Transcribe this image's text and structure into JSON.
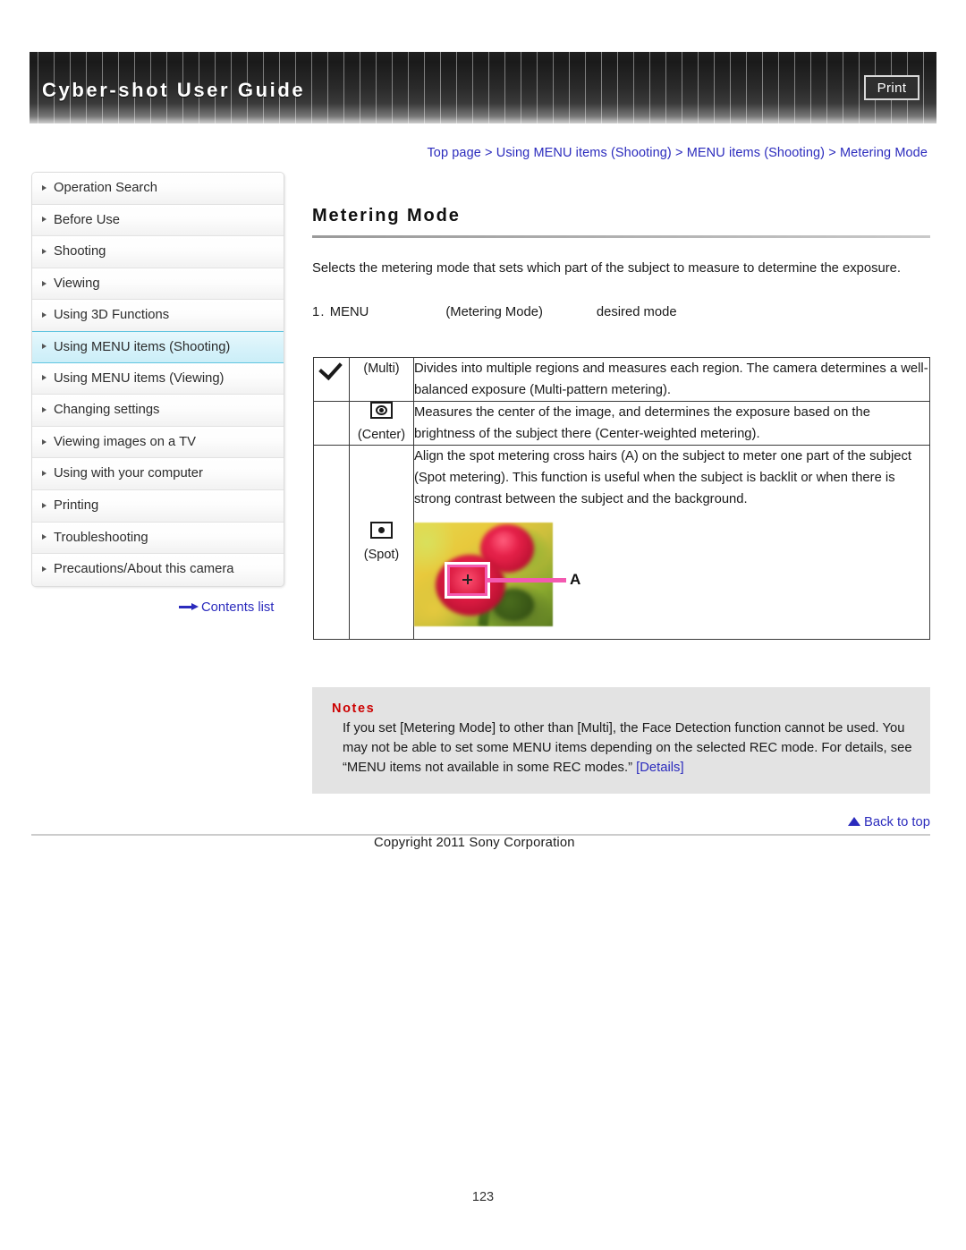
{
  "header": {
    "title": "Cyber-shot User Guide",
    "print_label": "Print"
  },
  "breadcrumb": {
    "full": "Top page > Using MENU items (Shooting) > MENU items (Shooting) > Metering Mode",
    "items": [
      "Top page",
      "Using MENU items (Shooting)",
      "MENU items (Shooting)",
      "Metering Mode"
    ],
    "separator": ">"
  },
  "sidebar": {
    "items": [
      {
        "label": "Operation Search",
        "active": false
      },
      {
        "label": "Before Use",
        "active": false
      },
      {
        "label": "Shooting",
        "active": false
      },
      {
        "label": "Viewing",
        "active": false
      },
      {
        "label": "Using 3D Functions",
        "active": false
      },
      {
        "label": "Using MENU items (Shooting)",
        "active": true
      },
      {
        "label": "Using MENU items (Viewing)",
        "active": false
      },
      {
        "label": "Changing settings",
        "active": false
      },
      {
        "label": "Viewing images on a TV",
        "active": false
      },
      {
        "label": "Using with your computer",
        "active": false
      },
      {
        "label": "Printing",
        "active": false
      },
      {
        "label": "Troubleshooting",
        "active": false
      },
      {
        "label": "Precautions/About this camera",
        "active": false
      }
    ],
    "contents_link": "Contents list"
  },
  "main": {
    "title": "Metering Mode",
    "intro": "Selects the metering mode that sets which part of the subject to measure to determine the exposure.",
    "step": {
      "number": "1.",
      "menu": "MENU",
      "setting": "(Metering Mode)",
      "target": "desired mode"
    },
    "table": {
      "rows": [
        {
          "checked": true,
          "icon": "check-icon",
          "label": "(Multi)",
          "description": "Divides into multiple regions and measures each region. The camera determines a well-balanced exposure (Multi-pattern metering)."
        },
        {
          "checked": false,
          "icon": "center-metering-icon",
          "label": "(Center)",
          "description": "Measures the center of the image, and determines the exposure based on the brightness of the subject there (Center-weighted metering)."
        },
        {
          "checked": false,
          "icon": "spot-metering-icon",
          "label": "(Spot)",
          "description": "Align the spot metering cross hairs (A) on the subject to meter one part of the subject (Spot metering). This function is useful when the subject is backlit or when there is strong contrast between the subject and the background.",
          "photo_caption": "A"
        }
      ]
    },
    "notes": {
      "title": "Notes",
      "body_1": "If you set [Metering Mode] to other than [Multi], the Face Detection function cannot be used. You may not be able to set some MENU items depending on the selected REC mode. For details, see “MENU items not available in some REC modes.” ",
      "details_link": "[Details]"
    }
  },
  "footer": {
    "back_to_top": "Back to top",
    "copyright": "Copyright 2011 Sony Corporation",
    "page_number": "123"
  },
  "colors": {
    "link": "#2b2bbd",
    "notes_title": "#cc0000",
    "notes_bg": "#e3e3e3",
    "active_nav": "#d6f2fa",
    "active_nav_border": "#5fc4e0",
    "spot_frame": "#f35ab0"
  }
}
